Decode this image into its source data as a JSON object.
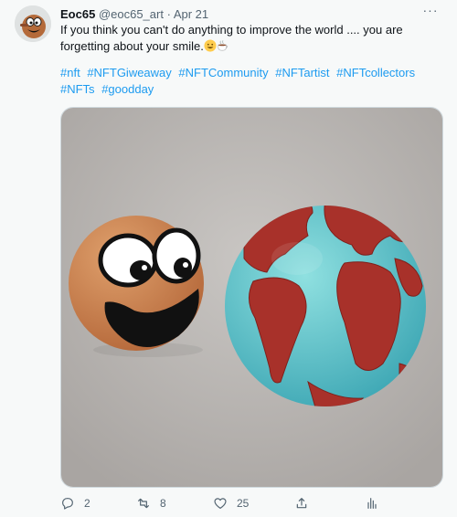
{
  "tweet": {
    "author_name": "Eoc65",
    "handle": "@eoc65_art",
    "separator": "·",
    "date": "Apr 21",
    "more_label": "···",
    "text": "If you think you can't do anything to improve the world .... you are forgetting about your smile.",
    "emojis": [
      "smiling-face-emoji",
      "hot-beverage-emoji"
    ],
    "hashtags": [
      "#nft",
      "#NFTGiweaway",
      "#NFTCommunity",
      "#NFTartist",
      "#NFTcollectors",
      "#NFTs",
      "#goodday"
    ]
  },
  "actions": {
    "reply": {
      "icon": "reply-icon",
      "count": "2"
    },
    "retweet": {
      "icon": "retweet-icon",
      "count": "8"
    },
    "like": {
      "icon": "heart-icon",
      "count": "25"
    },
    "share": {
      "icon": "share-icon"
    },
    "analytics": {
      "icon": "analytics-icon"
    }
  },
  "colors": {
    "link": "#1d9bf0",
    "muted": "#536471",
    "text": "#0f1419",
    "background": "#f7f9f9"
  }
}
